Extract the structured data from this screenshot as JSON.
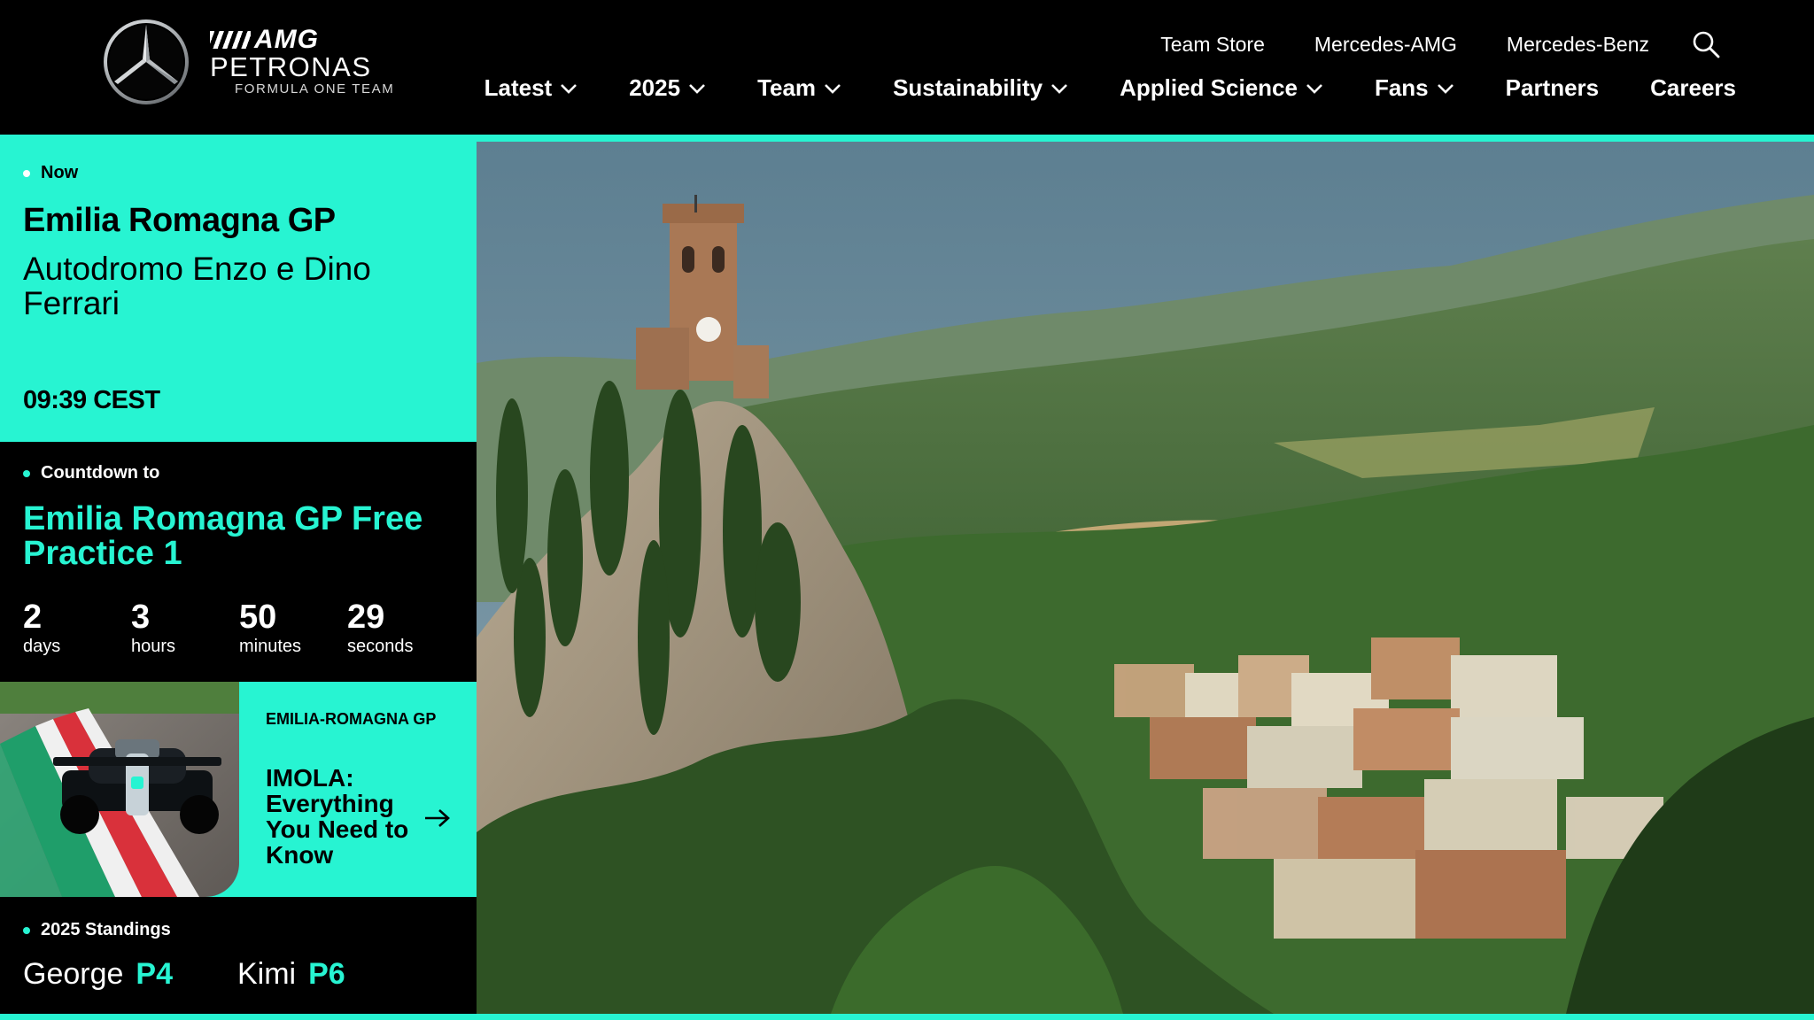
{
  "header": {
    "brand": {
      "amg": "AMG",
      "petronas": "PETRONAS",
      "subtitle": "FORMULA ONE TEAM"
    },
    "utility_nav": [
      "Team Store",
      "Mercedes-AMG",
      "Mercedes-Benz"
    ],
    "search_icon": "search-icon",
    "main_nav": [
      {
        "label": "Latest",
        "has_dropdown": true
      },
      {
        "label": "2025",
        "has_dropdown": true
      },
      {
        "label": "Team",
        "has_dropdown": true
      },
      {
        "label": "Sustainability",
        "has_dropdown": true
      },
      {
        "label": "Applied Science",
        "has_dropdown": true
      },
      {
        "label": "Fans",
        "has_dropdown": true
      },
      {
        "label": "Partners",
        "has_dropdown": false
      },
      {
        "label": "Careers",
        "has_dropdown": false
      }
    ]
  },
  "now": {
    "eyebrow": "Now",
    "race": "Emilia Romagna GP",
    "circuit": "Autodromo Enzo e Dino Ferrari",
    "time": "09:39 CEST"
  },
  "countdown": {
    "eyebrow": "Countdown to",
    "session": "Emilia Romagna GP Free Practice 1",
    "units": [
      {
        "value": "2",
        "label": "days"
      },
      {
        "value": "3",
        "label": "hours"
      },
      {
        "value": "50",
        "label": "minutes"
      },
      {
        "value": "29",
        "label": "seconds"
      }
    ]
  },
  "article": {
    "tag": "EMILIA-ROMAGNA GP",
    "title": "IMOLA: Everything You Need to Know"
  },
  "standings": {
    "eyebrow": "2025 Standings",
    "drivers": [
      {
        "name": "George",
        "position": "P4"
      },
      {
        "name": "Kimi",
        "position": "P6"
      }
    ]
  },
  "colors": {
    "accent": "#27f4d2",
    "background": "#000000",
    "panel_text": "#000000"
  }
}
